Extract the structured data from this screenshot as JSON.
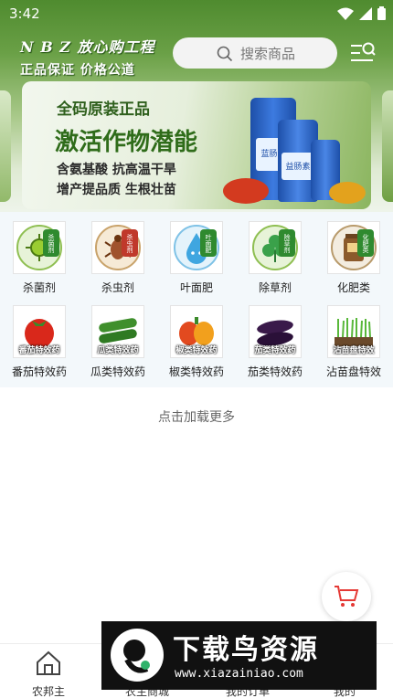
{
  "status_bar": {
    "time": "3:42"
  },
  "header": {
    "logo_line1": "N B Z 放心购工程",
    "logo_line2": "正品保证 价格公道",
    "search_placeholder": "搜索商品"
  },
  "banner": {
    "line1": "全码原装正品",
    "line2": "激活作物潜能",
    "line3": "含氨基酸 抗高温干旱",
    "line4": "增产提品质 生根壮苗",
    "bottle_labels": [
      "蓝肠素",
      "益肠素"
    ]
  },
  "categories": [
    {
      "label": "杀菌剂",
      "badge": "杀菌剂",
      "color": "#2f8a2f"
    },
    {
      "label": "杀虫剂",
      "badge": "杀虫剂",
      "color": "#c0392b"
    },
    {
      "label": "叶面肥",
      "badge": "叶面肥",
      "color": "#2f8a2f"
    },
    {
      "label": "除草剂",
      "badge": "除草剂",
      "color": "#2f8a2f"
    },
    {
      "label": "化肥类",
      "badge": "化肥类",
      "color": "#2f8a2f"
    },
    {
      "label": "番茄特效药",
      "badge": "番茄特效药"
    },
    {
      "label": "瓜类特效药",
      "badge": "瓜类特效药"
    },
    {
      "label": "椒类特效药",
      "badge": "椒类特效药"
    },
    {
      "label": "茄类特效药",
      "badge": "茄类特效药"
    },
    {
      "label": "沾苗盘特效",
      "badge": "沾苗盘特效"
    }
  ],
  "load_more": "点击加载更多",
  "tabbar": {
    "items": [
      {
        "label": "农邦主",
        "icon": "home-icon"
      },
      {
        "label": "农主商城",
        "icon": "shop-icon"
      },
      {
        "label": "我的订单",
        "icon": "order-icon"
      },
      {
        "label": "我的",
        "icon": "user-icon"
      }
    ]
  },
  "watermark": {
    "title": "下载鸟资源",
    "url": "www.xiazainiao.com"
  },
  "colors": {
    "primary_green": "#4f8b2f",
    "cart_red": "#e53935"
  }
}
